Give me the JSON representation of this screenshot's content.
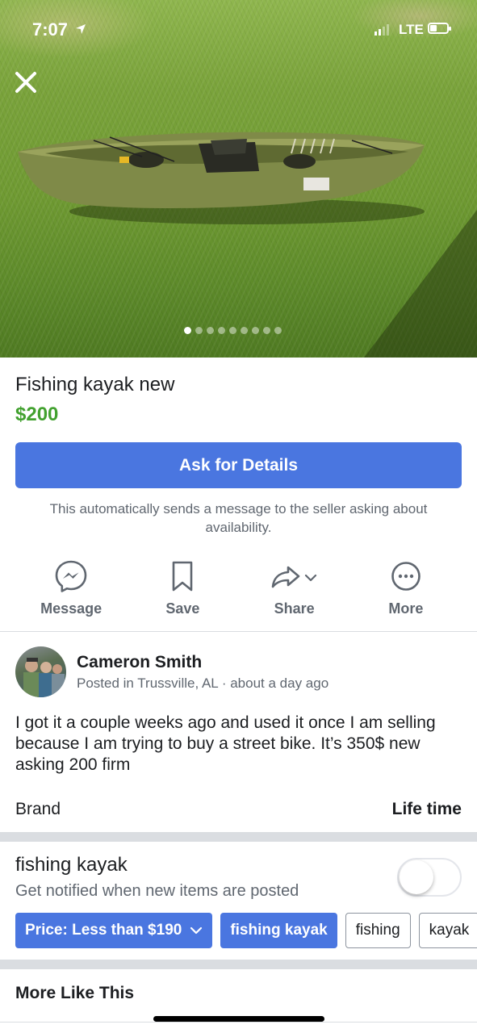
{
  "status_bar": {
    "time": "7:07",
    "network": "LTE"
  },
  "photo": {
    "image_count": 9,
    "active_index": 0,
    "close_icon": "close-icon"
  },
  "listing": {
    "title": "Fishing kayak new",
    "price": "$200",
    "price_color": "#42a12f"
  },
  "ask": {
    "button_label": "Ask for Details",
    "note": "This automatically sends a message to the seller asking about availability.",
    "color": "#4a76e0"
  },
  "actions": [
    {
      "label": "Message",
      "icon": "messenger-icon"
    },
    {
      "label": "Save",
      "icon": "bookmark-icon"
    },
    {
      "label": "Share",
      "icon": "share-arrow-icon"
    },
    {
      "label": "More",
      "icon": "more-dots-icon"
    }
  ],
  "seller": {
    "name": "Cameron Smith",
    "meta": "Posted in Trussville, AL · about a day ago"
  },
  "description": "I got it a couple weeks ago and used it once I am selling because I am trying to buy a street bike. It’s 350$ new asking 200 firm",
  "details": [
    {
      "label": "Brand",
      "value": "Life time"
    }
  ],
  "alert": {
    "title": "fishing kayak",
    "subtitle": "Get notified when new items are posted",
    "enabled": false
  },
  "chips": [
    {
      "label": "Price: Less than $190",
      "style": "primary",
      "dropdown": true
    },
    {
      "label": "fishing kayak",
      "style": "primary",
      "dropdown": false
    },
    {
      "label": "fishing",
      "style": "outline",
      "dropdown": false
    },
    {
      "label": "kayak",
      "style": "outline",
      "dropdown": false
    }
  ],
  "more_like_this": "More Like This"
}
